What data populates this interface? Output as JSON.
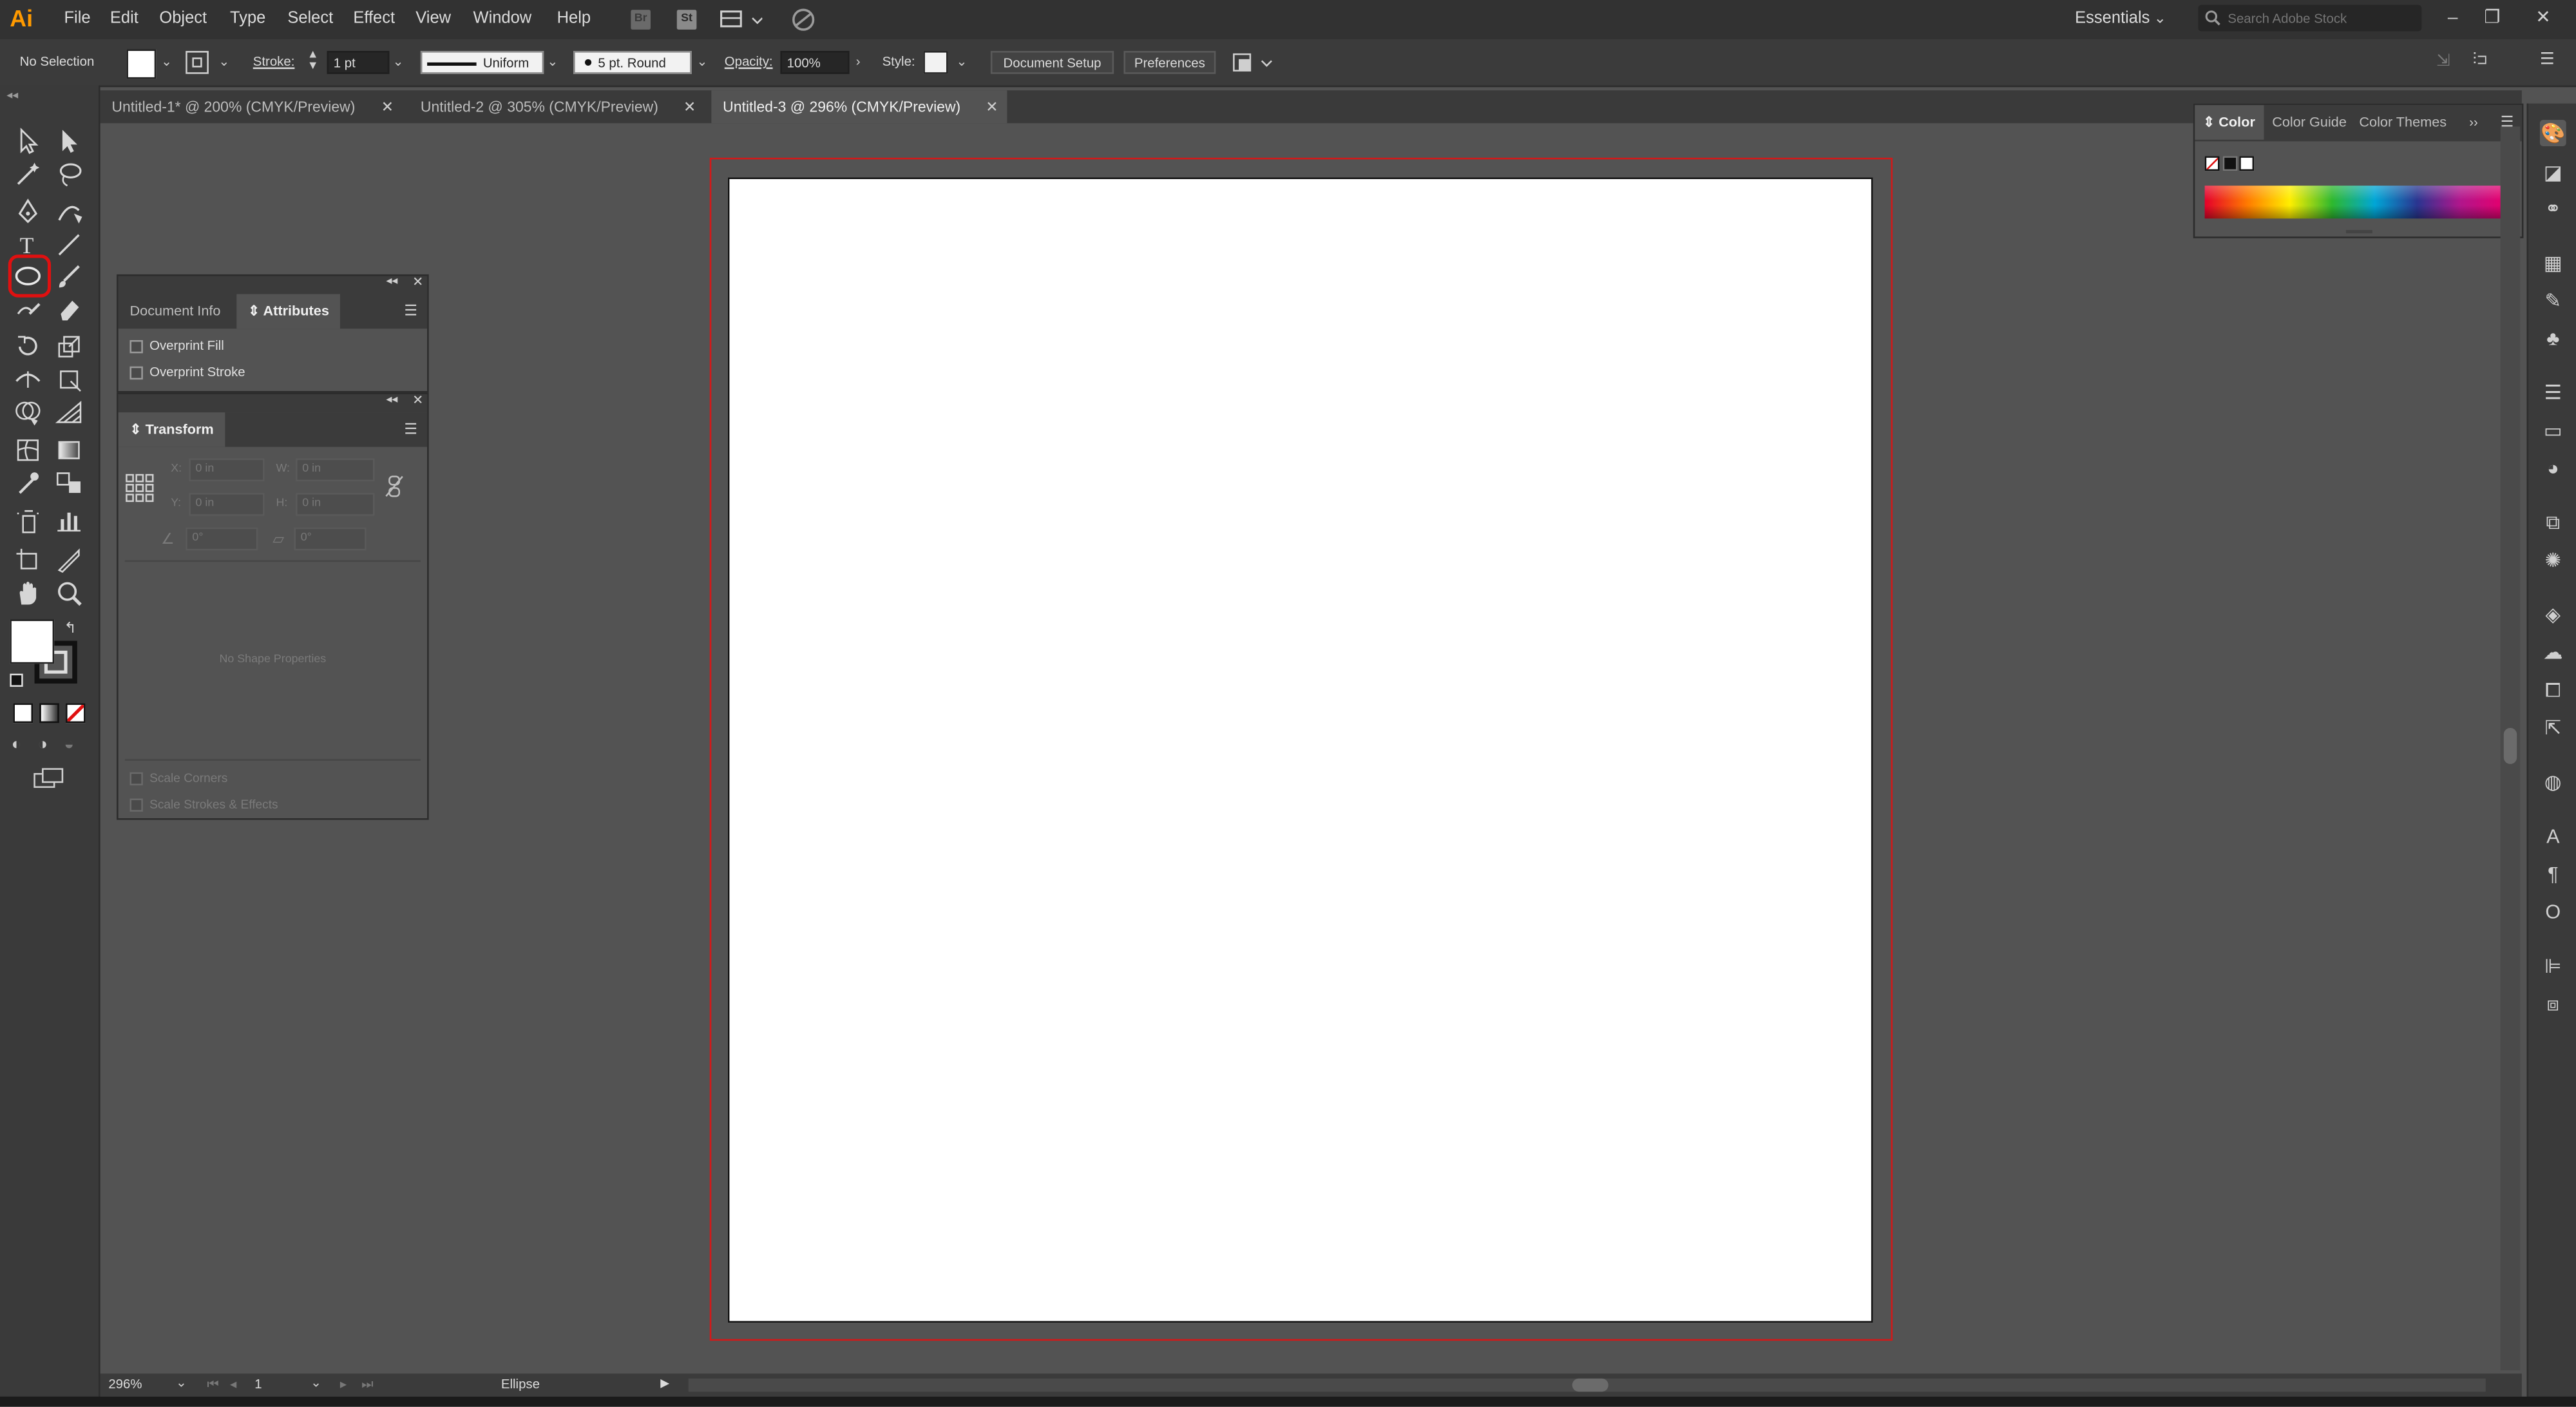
{
  "app": {
    "logo": "Ai"
  },
  "menubar": {
    "items": [
      "File",
      "Edit",
      "Object",
      "Type",
      "Select",
      "Effect",
      "View",
      "Window",
      "Help"
    ],
    "bridge_label": "Br",
    "stock_label": "St",
    "workspace": "Essentials",
    "search_placeholder": "Search Adobe Stock"
  },
  "control_bar": {
    "selection_status": "No Selection",
    "stroke_label": "Stroke:",
    "stroke_weight": "1 pt",
    "stroke_profile": "Uniform",
    "brush": "5 pt. Round",
    "opacity_label": "Opacity:",
    "opacity_value": "100%",
    "style_label": "Style:",
    "document_setup": "Document Setup",
    "preferences": "Preferences"
  },
  "tabs": [
    {
      "label": "Untitled-1* @ 200% (CMYK/Preview)",
      "active": false
    },
    {
      "label": "Untitled-2 @ 305% (CMYK/Preview)",
      "active": false
    },
    {
      "label": "Untitled-3 @ 296% (CMYK/Preview)",
      "active": true
    }
  ],
  "attributes_panel": {
    "tabs": [
      "Document Info",
      "Attributes"
    ],
    "active_tab": "Attributes",
    "overprint_fill": "Overprint Fill",
    "overprint_stroke": "Overprint Stroke"
  },
  "transform_panel": {
    "title": "Transform",
    "x_label": "X:",
    "x_value": "0 in",
    "y_label": "Y:",
    "y_value": "0 in",
    "w_label": "W:",
    "w_value": "0 in",
    "h_label": "H:",
    "h_value": "0 in",
    "angle_value": "0°",
    "shear_value": "0°",
    "no_shape": "No Shape Properties",
    "scale_corners": "Scale Corners",
    "scale_strokes": "Scale Strokes & Effects"
  },
  "color_panel": {
    "tabs": [
      "Color",
      "Color Guide",
      "Color Themes"
    ],
    "active_tab": "Color"
  },
  "tools": {
    "active_tool": "ellipse-tool",
    "highlight_color": "#e01010"
  },
  "status_bar": {
    "zoom": "296%",
    "artboard_number": "1",
    "current_tool": "Ellipse"
  },
  "colors": {
    "accent_logo": "#ff9a00",
    "artboard_bleed": "#d21919",
    "canvas": "#535353"
  }
}
